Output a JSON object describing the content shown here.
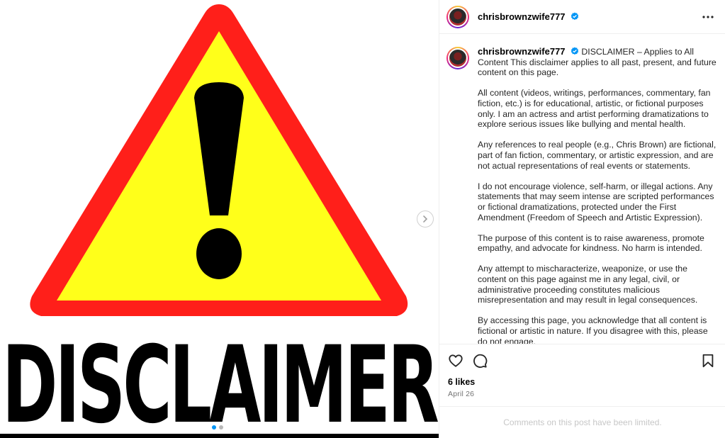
{
  "post": {
    "image": {
      "sign_word": "DISCLAIMER",
      "warning_colors": {
        "border": "#ff1f1a",
        "fill": "#ffff1a",
        "mark": "#000000"
      },
      "carousel": {
        "current": 1,
        "total": 2
      }
    },
    "author": {
      "username": "chrisbrownzwife777",
      "verified": true
    },
    "caption": {
      "username": "chrisbrownzwife777",
      "paragraphs": [
        "DISCLAIMER – Applies to All Content This disclaimer applies to all past, present, and future content on this page.",
        "All content (videos, writings, performances, commentary, fan fiction, etc.) is for educational, artistic, or fictional purposes only. I am an actress and artist performing dramatizations to explore serious issues like bullying and mental health.",
        "Any references to real people (e.g., Chris Brown) are fictional, part of fan fiction, commentary, or artistic expression, and are not actual representations of real events or statements.",
        "I do not encourage violence, self-harm, or illegal actions. Any statements that may seem intense are scripted performances or fictional dramatizations, protected under the First Amendment (Freedom of Speech and Artistic Expression).",
        "The purpose of this content is to raise awareness, promote empathy, and advocate for kindness. No harm is intended.",
        "Any attempt to mischaracterize, weaponize, or use the content on this page against me in any legal, civil, or administrative proceeding constitutes malicious misrepresentation and may result in legal consequences.",
        "By accessing this page, you acknowledge that all content is fictional or artistic in nature. If you disagree with this, please do not engage."
      ]
    },
    "likes": "6 likes",
    "date": "April 26",
    "comments_notice": "Comments on this post have been limited.",
    "icons": {
      "more": "more-options-icon",
      "like": "heart-icon",
      "comment": "comment-icon",
      "save": "bookmark-icon",
      "verified": "verified-badge-icon",
      "next": "chevron-right-icon"
    },
    "colors": {
      "verified": "#0095f6",
      "muted": "#737373",
      "divider": "#efefef"
    }
  }
}
